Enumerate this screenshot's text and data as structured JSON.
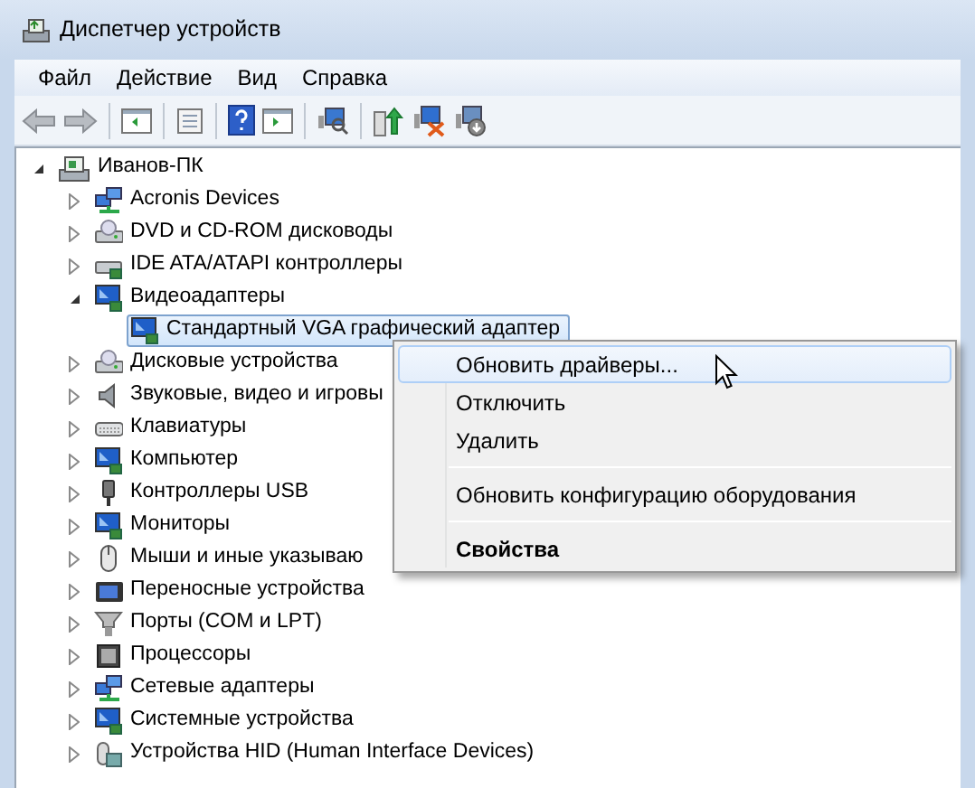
{
  "window": {
    "title": "Диспетчер устройств"
  },
  "menu_bar": [
    "Файл",
    "Действие",
    "Вид",
    "Справка"
  ],
  "tree": {
    "label": "Иванов-ПК",
    "expanded": true,
    "selected": false,
    "children": [
      {
        "label": "Acronis Devices",
        "expanded": false,
        "selected": false
      },
      {
        "label": "DVD и CD-ROM дисководы",
        "expanded": false,
        "selected": false
      },
      {
        "label": "IDE ATA/ATAPI контроллеры",
        "expanded": false,
        "selected": false
      },
      {
        "label": "Видеоадаптеры",
        "expanded": true,
        "selected": false,
        "children": [
          {
            "label": "Стандартный VGA графический адаптер",
            "selected": true
          }
        ]
      },
      {
        "label": "Дисковые устройства",
        "expanded": false,
        "selected": false
      },
      {
        "label": "Звуковые, видео и игровы",
        "expanded": false,
        "selected": false
      },
      {
        "label": "Клавиатуры",
        "expanded": false,
        "selected": false
      },
      {
        "label": "Компьютер",
        "expanded": false,
        "selected": false
      },
      {
        "label": "Контроллеры USB",
        "expanded": false,
        "selected": false
      },
      {
        "label": "Мониторы",
        "expanded": false,
        "selected": false
      },
      {
        "label": "Мыши и иные указываю",
        "expanded": false,
        "selected": false
      },
      {
        "label": "Переносные устройства",
        "expanded": false,
        "selected": false
      },
      {
        "label": "Порты (COM и LPT)",
        "expanded": false,
        "selected": false
      },
      {
        "label": "Процессоры",
        "expanded": false,
        "selected": false
      },
      {
        "label": "Сетевые адаптеры",
        "expanded": false,
        "selected": false
      },
      {
        "label": "Системные устройства",
        "expanded": false,
        "selected": false
      },
      {
        "label": "Устройства HID (Human Interface Devices)",
        "expanded": false,
        "selected": false
      }
    ]
  },
  "context_menu": [
    {
      "kind": "item",
      "label": "Обновить драйверы...",
      "selected": true
    },
    {
      "kind": "item",
      "label": "Отключить",
      "selected": false
    },
    {
      "kind": "item",
      "label": "Удалить",
      "selected": false
    },
    {
      "kind": "separator"
    },
    {
      "kind": "item",
      "label": "Обновить конфигурацию оборудования",
      "selected": false
    },
    {
      "kind": "separator"
    },
    {
      "kind": "default",
      "label": "Свойства",
      "selected": false
    }
  ]
}
